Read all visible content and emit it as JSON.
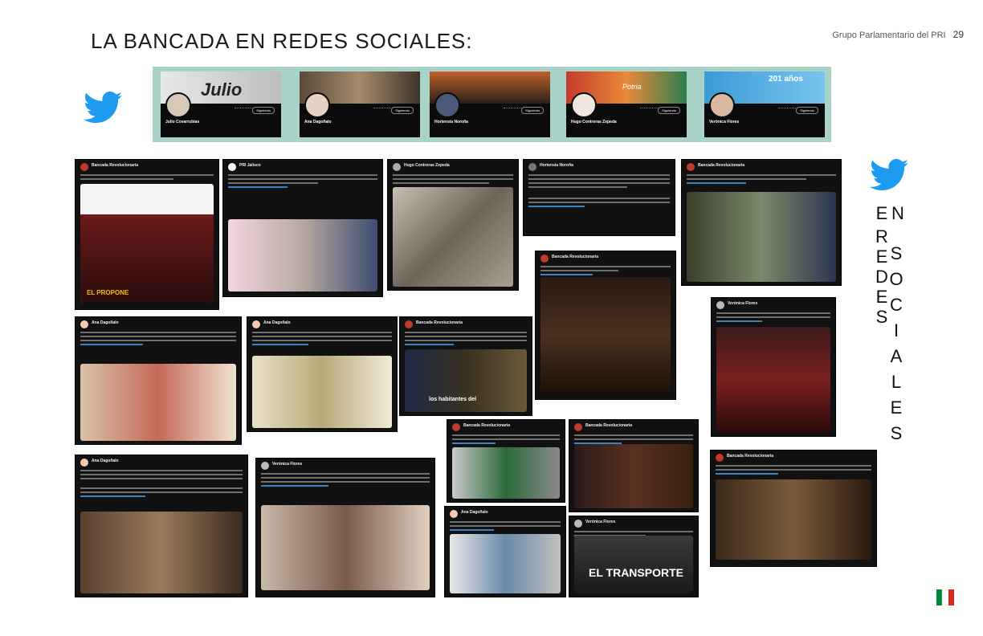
{
  "page": {
    "title": "LA BANCADA EN REDES SOCIALES:",
    "header_right": "Grupo Parlamentario del PRI",
    "page_number": "29"
  },
  "icons": {
    "left_bird": "twitter-bird-icon",
    "right_bird": "twitter-bird-icon",
    "logo": "pri-logo-icon"
  },
  "colors": {
    "twitter_blue": "#1d9bf0",
    "strip_bg": "#a9d3c9",
    "pri_red": "#d52b1e",
    "pri_green": "#00843d"
  },
  "vertical_text": {
    "col1": [
      "E",
      "N"
    ],
    "col2": [
      "R",
      "E",
      "D",
      "E",
      "S"
    ],
    "col3": [
      "S",
      "O",
      "C",
      "I",
      "A",
      "L",
      "E",
      "S"
    ]
  },
  "profiles": [
    {
      "name": "Julio Covarrubias",
      "banner_text": "Julio",
      "follow": "Siguiendo"
    },
    {
      "name": "Ana Dagoñalo",
      "follow": "Siguiendo"
    },
    {
      "name": "Hortensia Noroña",
      "follow": "Siguiendo"
    },
    {
      "name": "Hugo Contreras Zepeda",
      "banner_text": "Potria",
      "follow": "Siguiendo"
    },
    {
      "name": "Verónica Flores",
      "banner_text": "201 años",
      "follow": "Siguiendo"
    }
  ],
  "tweets": {
    "t1": {
      "author": "Bancada Revolucionaria",
      "overlay": "EL PROPONE"
    },
    "t2": {
      "author": "PRI Jalisco"
    },
    "t3": {
      "author": "Hugo Contreras Zepeda"
    },
    "t4": {
      "author": "Hortensia Noroña"
    },
    "t5": {
      "author": "Bancada Revolucionaria"
    },
    "t6": {
      "author": "Ana Dagoñalo"
    },
    "t7": {
      "author": "Ana Dagoñalo"
    },
    "t8": {
      "author": "Bancada Revolucionaria",
      "overlay": "los habitantes del"
    },
    "t9": {
      "author": "Bancada Revolucionaria"
    },
    "t10": {
      "author": "Bancada Revolucionaria"
    },
    "t11": {
      "author": "Verónica Flores"
    },
    "t12": {
      "author": "Ana Dagoñalo"
    },
    "t13": {
      "author": "Verónica Flores"
    },
    "t14": {
      "author": "Bancada Revolucionaria"
    },
    "t15": {
      "author": "Ana Dagoñalo"
    },
    "t16": {
      "author": "Ana Dagoñalo"
    },
    "t17": {
      "author": "Verónica Flores",
      "overlay": "EL TRANSPORTE"
    },
    "t18": {
      "author": "Bancada Revolucionaria"
    }
  }
}
